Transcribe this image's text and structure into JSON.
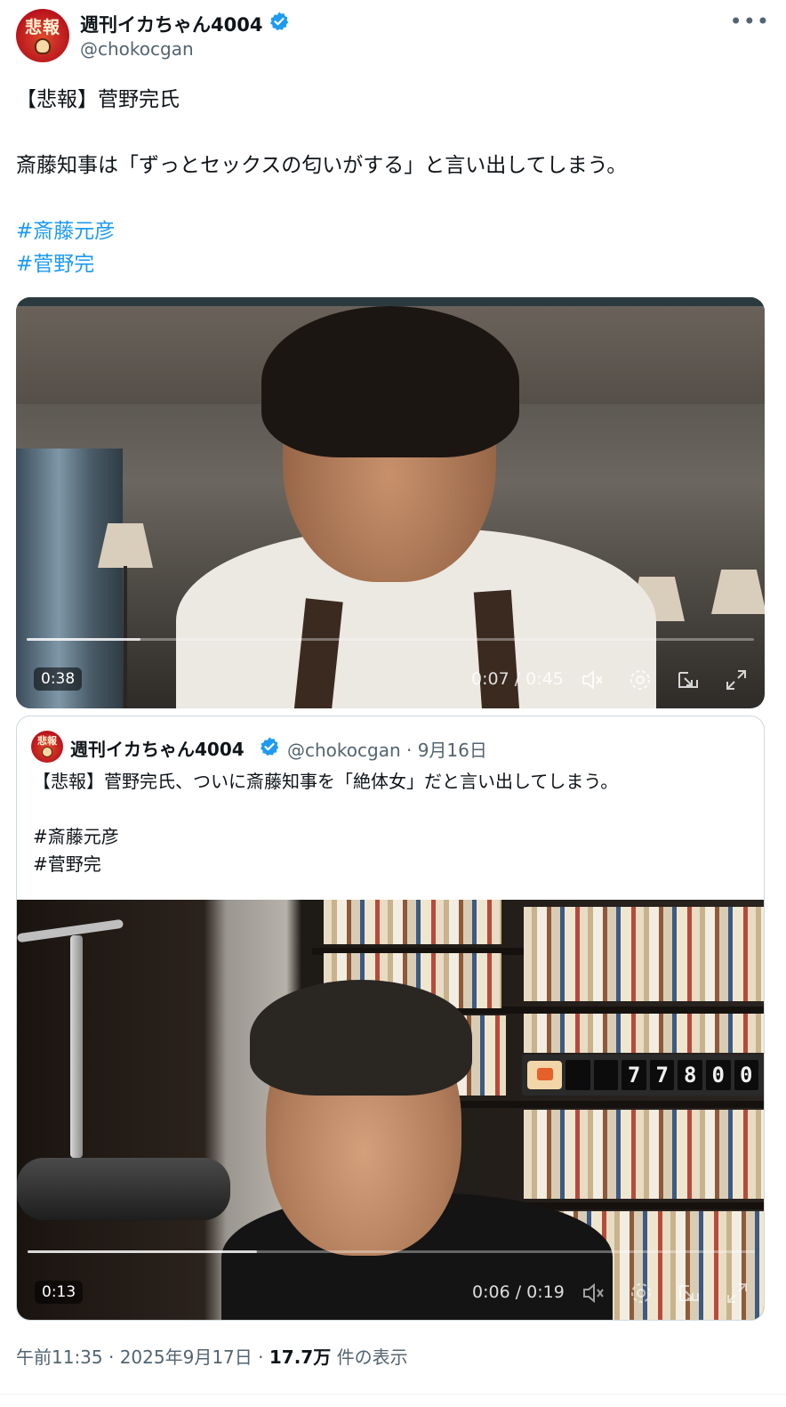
{
  "author": {
    "display_name": "週刊イカちゃん4004",
    "handle": "@chokocgan",
    "avatar_text": "悲報",
    "verified": true
  },
  "post": {
    "lines": [
      "【悲報】菅野完氏",
      "",
      "斎藤知事は「ずっとセックスの匂いがする」と言い出してしまう。",
      ""
    ],
    "hashtags": [
      "#斎藤元彦",
      "#菅野完"
    ]
  },
  "video_main": {
    "duration_badge": "0:38",
    "time_readout": "0:07 / 0:45",
    "progress": 0.156
  },
  "quoted": {
    "display_name": "週刊イカちゃん4004",
    "handle_date": "@chokocgan · 9月16日",
    "avatar_text": "悲報",
    "lines": [
      "【悲報】菅野完氏、ついに斎藤知事を「絶体女」だと言い出してしまう。",
      "",
      "#斎藤元彦",
      "#菅野完"
    ],
    "counter_digits": [
      "",
      "",
      "7",
      "7",
      "8",
      "0",
      "0"
    ],
    "video": {
      "duration_badge": "0:13",
      "time_readout": "0:06 / 0:19",
      "progress": 0.316
    }
  },
  "meta": {
    "time": "午前11:35 · 2025年9月17日 · ",
    "views": "17.7万",
    "views_label": " 件の表示"
  },
  "colors": {
    "accent": "#1d9bf0",
    "text": "#0f1419",
    "muted": "#536471",
    "border": "#cfd9de"
  },
  "icons": [
    "more-icon",
    "verified-icon",
    "mute-icon",
    "settings-icon",
    "pip-icon",
    "fullscreen-icon"
  ]
}
